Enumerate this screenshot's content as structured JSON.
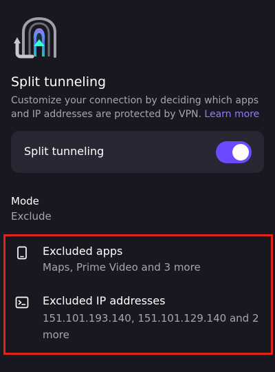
{
  "header": {
    "icon": "split-tunnel-icon",
    "title": "Split tunneling",
    "description": "Customize your connection by deciding which apps and IP addresses are protected by VPN.",
    "learn_more": "Learn more"
  },
  "toggle": {
    "label": "Split tunneling",
    "enabled": true,
    "accent": "#6D4AFF"
  },
  "mode": {
    "label": "Mode",
    "value": "Exclude"
  },
  "settings": [
    {
      "icon": "phone-icon",
      "title": "Excluded apps",
      "subtitle": "Maps, Prime Video and 3 more"
    },
    {
      "icon": "terminal-icon",
      "title": "Excluded IP addresses",
      "subtitle": "151.101.193.140, 151.101.129.140 and 2 more"
    }
  ],
  "colors": {
    "background": "#191820",
    "card": "#292733",
    "secondary_text": "#A7A4B5",
    "link": "#8B7DFF",
    "highlight": "#E32219"
  }
}
